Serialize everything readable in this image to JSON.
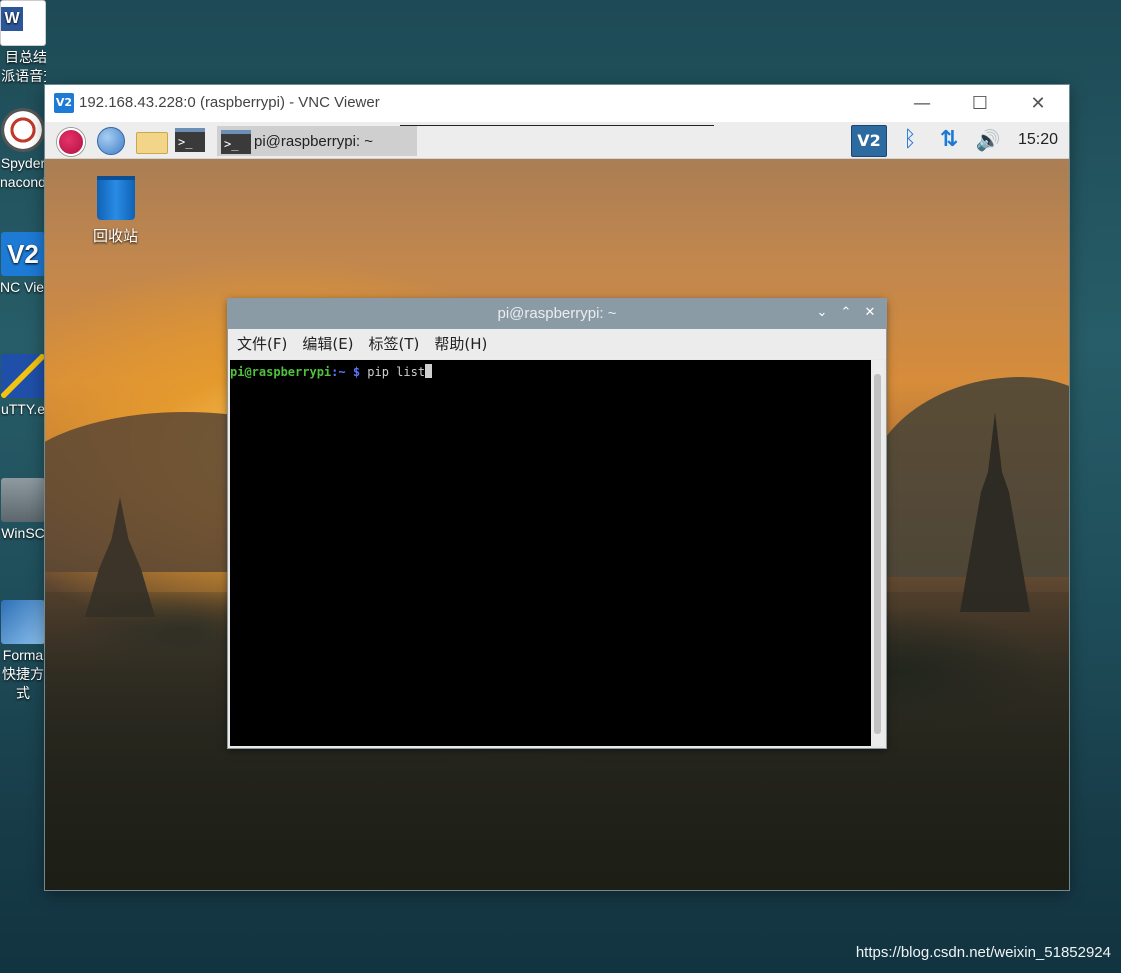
{
  "host_desktop": {
    "icons": [
      {
        "name": "word-doc-icon",
        "label": "目总结 树派语音交...",
        "color": "#2b579a"
      },
      {
        "name": "spyder-icon",
        "label": "Spyder naconda",
        "color": "#c0392b"
      },
      {
        "name": "vnc-viewer-icon",
        "label": "NC View",
        "color": "#1d7ad5"
      },
      {
        "name": "putty-icon",
        "label": "uTTY.e",
        "color": "#3c6ab1"
      },
      {
        "name": "winscp-icon",
        "label": "WinSC",
        "color": "#7b8b93"
      },
      {
        "name": "format-factory-icon",
        "label": "Forma 快捷方式",
        "color": "#2e6fb6"
      }
    ],
    "watermark": "https://blog.csdn.net/weixin_51852924"
  },
  "vnc_window": {
    "title": "192.168.43.228:0 (raspberrypi) - VNC Viewer",
    "app_icon_text": "V2",
    "controls": {
      "minimize": "—",
      "maximize": "☐",
      "close": "✕"
    }
  },
  "pi_panel": {
    "task_label": "pi@raspberrypi: ~",
    "vnc_tray_text": "V2",
    "bluetooth_glyph": "ᛒ",
    "network_glyph": "⇅",
    "volume_glyph": "🔊",
    "clock": "15:20",
    "terminal_glyph": ">_"
  },
  "pi_desktop": {
    "trash_label": "回收站"
  },
  "terminal": {
    "title": "pi@raspberrypi: ~",
    "menu": [
      "文件(F)",
      "编辑(E)",
      "标签(T)",
      "帮助(H)"
    ],
    "prompt_user": "pi@raspberrypi",
    "prompt_path": ":~",
    "prompt_sym": " $",
    "command": " pip list",
    "controls": {
      "minimize": "⌄",
      "maximize": "⌃",
      "close": "✕"
    }
  }
}
